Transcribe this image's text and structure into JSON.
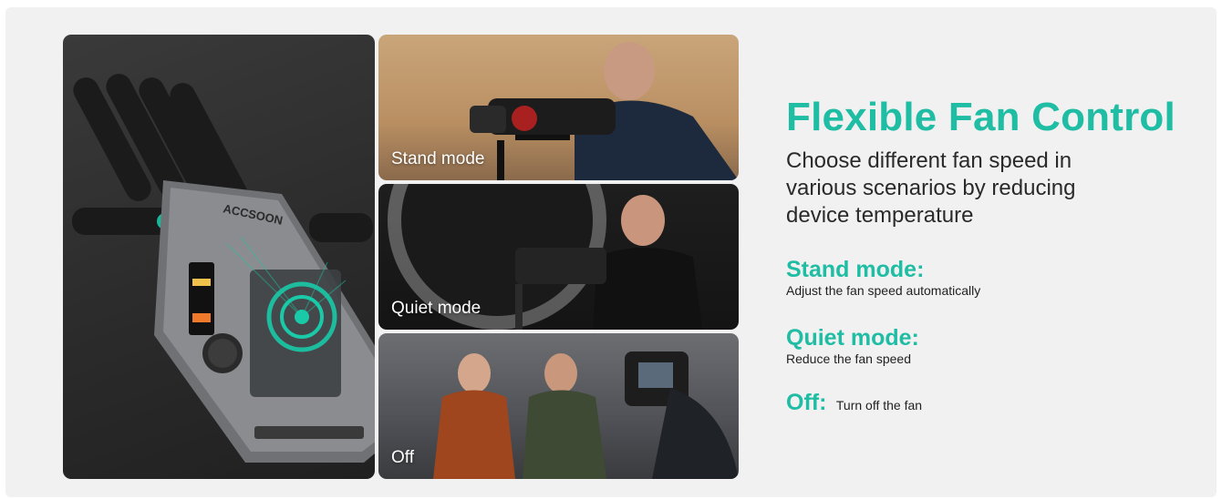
{
  "product": {
    "brand_label": "ACCSOON"
  },
  "photos": [
    {
      "label": "Stand mode"
    },
    {
      "label": "Quiet mode"
    },
    {
      "label": "Off"
    }
  ],
  "heading": {
    "title": "Flexible Fan Control",
    "subtitle": "Choose different fan speed in various scenarios by reducing device temperature"
  },
  "modes": [
    {
      "name": "Stand mode:",
      "description": "Adjust the fan speed automatically"
    },
    {
      "name": "Quiet mode:",
      "description": "Reduce the fan speed"
    },
    {
      "name": "Off:",
      "description": "Turn off the fan"
    }
  ],
  "colors": {
    "accent": "#1fbda4",
    "text": "#2a2a2a",
    "panel_bg": "#f1f1f1"
  }
}
